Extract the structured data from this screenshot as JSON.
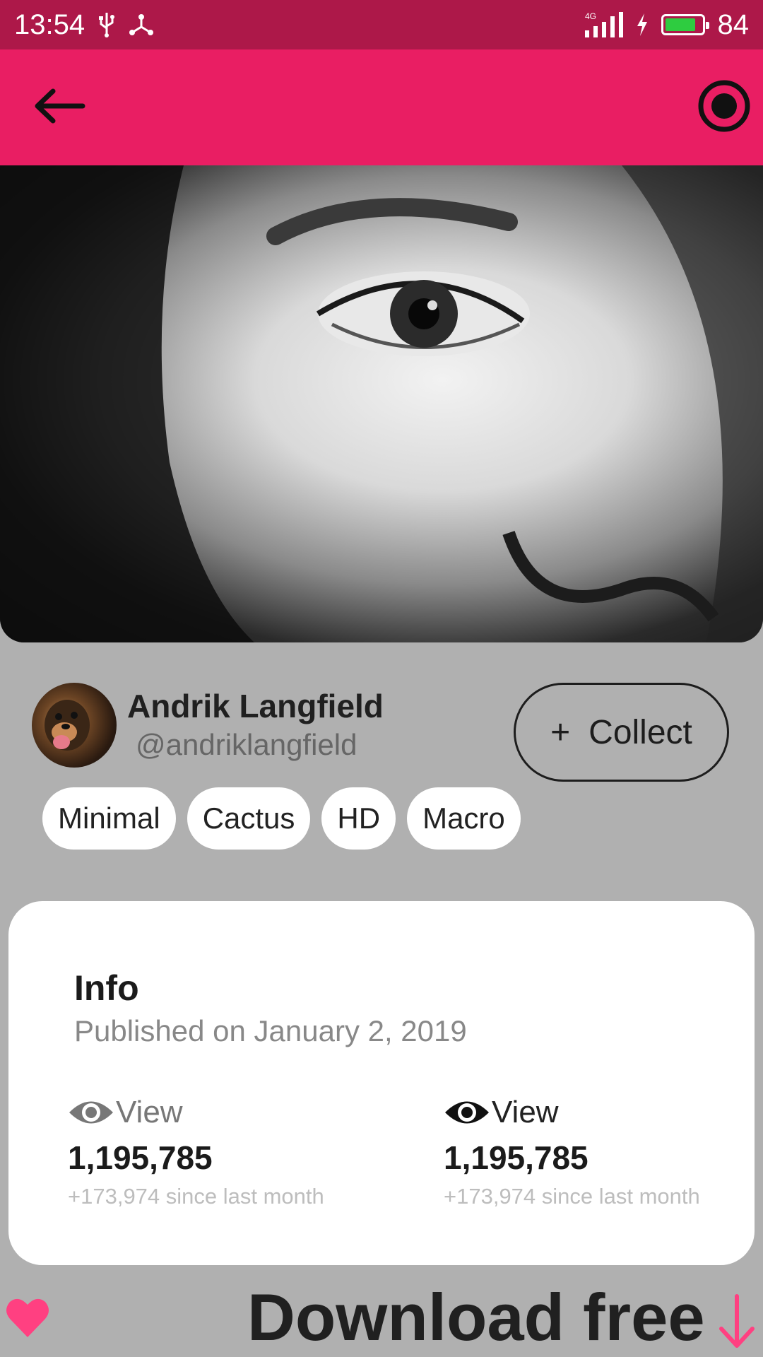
{
  "status_bar": {
    "time": "13:54",
    "network": "4G",
    "battery_level": "84",
    "battery_fraction": 0.84,
    "icons": [
      "usb-icon",
      "share-nodes-icon",
      "signal-icon",
      "charging-bolt-icon",
      "battery-icon"
    ]
  },
  "app_bar": {
    "back_icon": "arrow-left-icon",
    "action_icon": "record-icon",
    "color": "#e91e63"
  },
  "hero_image": {
    "description": "black-and-white close-up portrait"
  },
  "author": {
    "name": "Andrik Langfield",
    "handle": "@andriklangfield"
  },
  "collect_button": {
    "icon": "+",
    "label": "Collect"
  },
  "tags": [
    "Minimal",
    "Cactus",
    "HD",
    "Macro"
  ],
  "info": {
    "title": "Info",
    "published": "Published on January 2, 2019",
    "stats": [
      {
        "icon": "eye-icon",
        "label": "View",
        "value": "1,195,785",
        "delta": "+173,974 since last month"
      },
      {
        "icon": "eye-icon",
        "label": "View",
        "value": "1,195,785",
        "delta": "+173,974 since last month"
      }
    ]
  },
  "bottom": {
    "download_label": "Download free",
    "heart_icon": "heart-icon",
    "download_icon": "arrow-down-icon",
    "accent": "#ff4081"
  }
}
